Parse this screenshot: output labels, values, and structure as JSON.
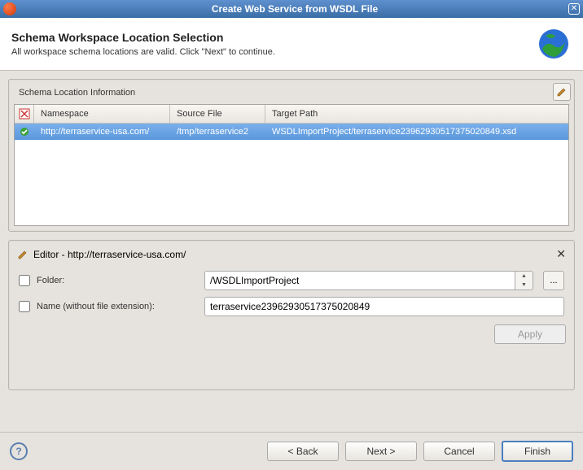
{
  "window": {
    "title": "Create Web Service from WSDL File"
  },
  "header": {
    "title": "Schema Workspace Location Selection",
    "subtitle": "All workspace schema locations are valid. Click \"Next\" to continue."
  },
  "schema_panel": {
    "title": "Schema Location Information",
    "columns": {
      "namespace": "Namespace",
      "source_file": "Source File",
      "target_path": "Target Path"
    },
    "rows": [
      {
        "namespace": "http://terraservice-usa.com/",
        "source_file": "/tmp/terraservice2",
        "target_path": "WSDLImportProject/terraservice23962930517375020849.xsd"
      }
    ]
  },
  "editor": {
    "title": "Editor - http://terraservice-usa.com/",
    "folder_label": "Folder:",
    "folder_value": "/WSDLImportProject",
    "name_label": "Name (without file extension):",
    "name_value": "terraservice23962930517375020849",
    "browse_label": "...",
    "apply_label": "Apply"
  },
  "footer": {
    "back": "< Back",
    "next": "Next >",
    "cancel": "Cancel",
    "finish": "Finish",
    "help": "?"
  }
}
